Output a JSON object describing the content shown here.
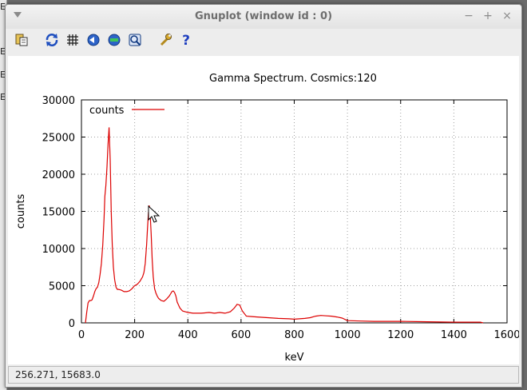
{
  "window": {
    "title": "Gnuplot (window id : 0)",
    "controls": {
      "minimize": "−",
      "maximize": "+",
      "close": "×"
    }
  },
  "toolbar": {
    "icons": [
      "copy-clipboard-icon",
      "replot-icon",
      "grid-icon",
      "unzoom-icon",
      "rezoom-icon",
      "zoom-icon",
      "settings-wrench-icon",
      "help-icon"
    ]
  },
  "colors": {
    "series": "#dd0000",
    "grid": "#a0a0a0"
  },
  "status": {
    "coordinates": "256.271,  15683.0"
  },
  "chart_data": {
    "type": "line",
    "title": "Gamma Spectrum.  Cosmics:120",
    "xlabel": "keV",
    "ylabel": "counts",
    "xlim": [
      0,
      1600
    ],
    "ylim": [
      0,
      30000
    ],
    "xticks": [
      0,
      200,
      400,
      600,
      800,
      1000,
      1200,
      1400,
      1600
    ],
    "yticks": [
      0,
      5000,
      10000,
      15000,
      20000,
      25000,
      30000
    ],
    "grid": true,
    "legend_position": "top-left",
    "series": [
      {
        "name": "counts",
        "color": "#dd0000",
        "x": [
          15,
          20,
          25,
          30,
          35,
          40,
          45,
          50,
          55,
          60,
          65,
          70,
          75,
          80,
          85,
          88,
          92,
          96,
          100,
          104,
          108,
          112,
          116,
          120,
          125,
          130,
          135,
          140,
          150,
          160,
          170,
          180,
          190,
          200,
          210,
          220,
          230,
          235,
          240,
          245,
          248,
          252,
          255,
          258,
          262,
          266,
          270,
          275,
          280,
          285,
          290,
          300,
          310,
          320,
          330,
          340,
          345,
          350,
          355,
          360,
          370,
          380,
          390,
          400,
          420,
          450,
          480,
          500,
          520,
          540,
          560,
          575,
          585,
          595,
          605,
          620,
          640,
          660,
          700,
          740,
          780,
          800,
          820,
          840,
          860,
          880,
          900,
          920,
          940,
          960,
          980,
          1000,
          1050,
          1100,
          1200,
          1300,
          1400,
          1500,
          1510
        ],
        "y": [
          0,
          1500,
          2700,
          3000,
          3000,
          3100,
          3600,
          4200,
          4600,
          4800,
          5400,
          6500,
          8000,
          10500,
          14000,
          17000,
          18500,
          21000,
          24000,
          26300,
          22000,
          15000,
          10500,
          7500,
          5800,
          4800,
          4500,
          4500,
          4400,
          4200,
          4200,
          4300,
          4600,
          5000,
          5200,
          5600,
          6200,
          6800,
          8000,
          10500,
          12500,
          14800,
          15800,
          15000,
          12000,
          8500,
          6200,
          4600,
          4000,
          3600,
          3300,
          3000,
          2900,
          3200,
          3600,
          4200,
          4300,
          4100,
          3600,
          2800,
          2000,
          1600,
          1500,
          1400,
          1300,
          1300,
          1400,
          1300,
          1400,
          1300,
          1500,
          2000,
          2500,
          2400,
          1600,
          900,
          850,
          800,
          700,
          600,
          550,
          500,
          550,
          600,
          700,
          900,
          1000,
          950,
          900,
          800,
          650,
          300,
          250,
          200,
          200,
          150,
          100,
          100,
          0
        ]
      }
    ]
  }
}
